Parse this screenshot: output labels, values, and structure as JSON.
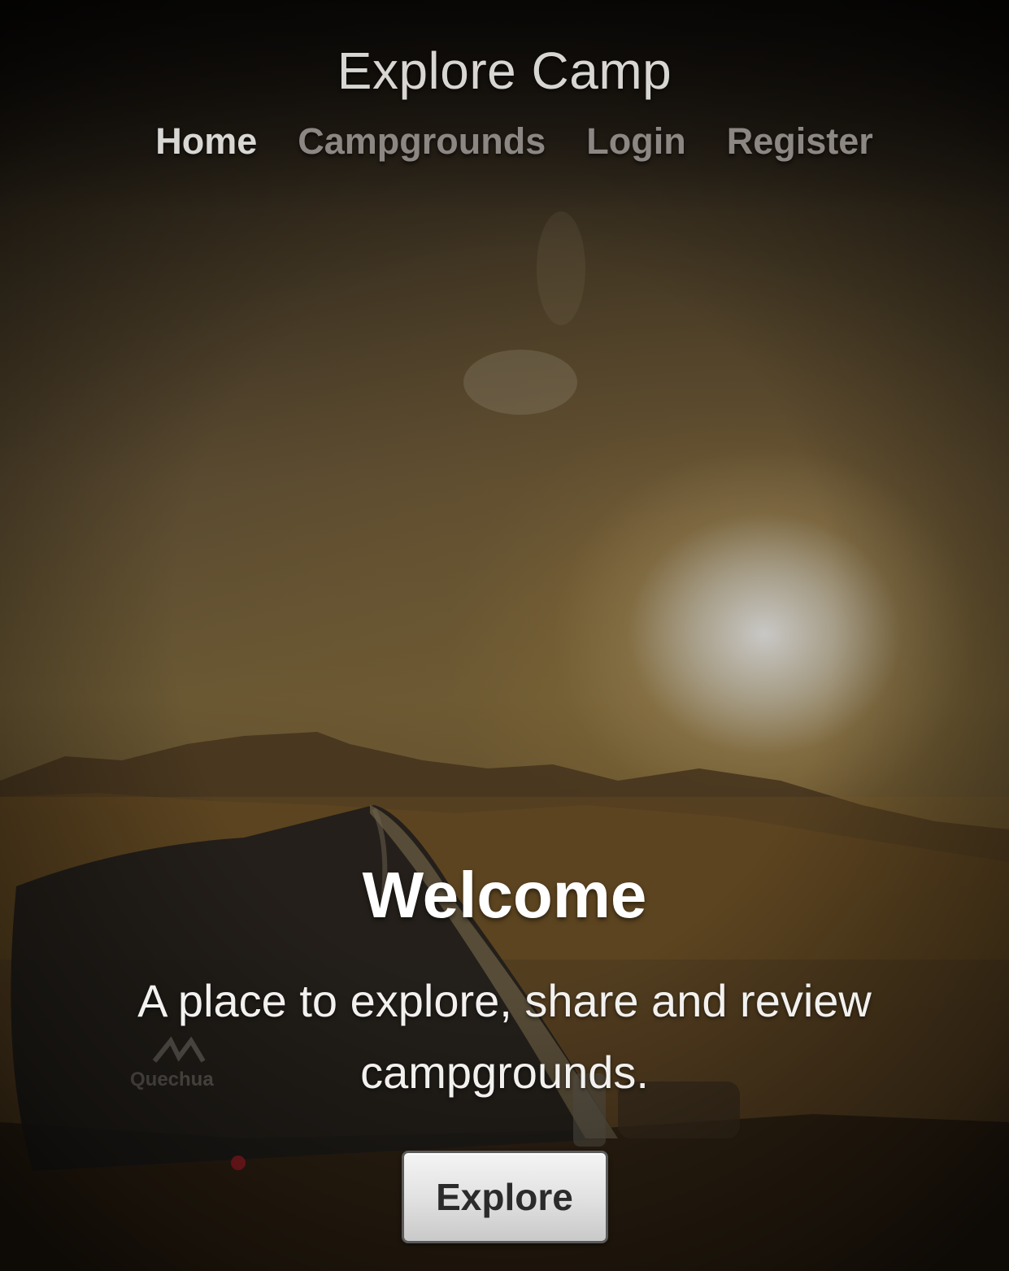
{
  "brand": {
    "title": "Explore Camp"
  },
  "nav": {
    "items": [
      {
        "label": "Home",
        "active": true
      },
      {
        "label": "Campgrounds",
        "active": false
      },
      {
        "label": "Login",
        "active": false
      },
      {
        "label": "Register",
        "active": false
      }
    ]
  },
  "hero": {
    "heading": "Welcome",
    "lead": "A place to explore, share and review campgrounds.",
    "button_label": "Explore"
  },
  "background": {
    "image_semantic": "sunset-campsite-photo",
    "tent_logo_text": "Quechua"
  },
  "colors": {
    "nav_active": "#d9d7d4",
    "nav_inactive": "#8c8782",
    "button_bg": "#e2e2e2",
    "button_text": "#2b2b2b"
  }
}
